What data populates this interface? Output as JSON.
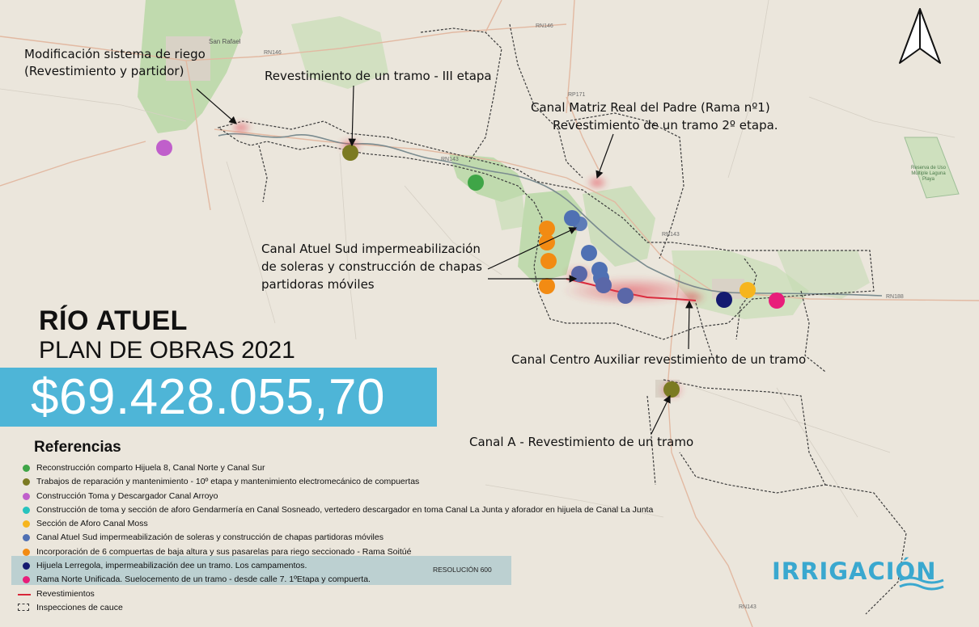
{
  "title": "RÍO ATUEL",
  "subtitle": "PLAN DE OBRAS 2021",
  "amount": "$69.428.055,70",
  "references_title": "Referencias",
  "legend": [
    {
      "text": "Reconstrucción comparto Hijuela 8, Canal Norte y Canal Sur",
      "color": "#3fa547"
    },
    {
      "text": "Trabajos de reparación y mantenimiento - 10º etapa y mantenimiento electromecánico de compuertas",
      "color": "#7b7a22"
    },
    {
      "text": "Construcción Toma y Descargador Canal Arroyo",
      "color": "#c05fcb"
    },
    {
      "text": "Construcción de toma y sección de aforo Gendarmería en Canal Sosneado, vertedero descargador en toma Canal La Junta y aforador en hijuela de Canal La Junta",
      "color": "#27c3be"
    },
    {
      "text": "Sección de Aforo Canal Moss",
      "color": "#f6b51e"
    },
    {
      "text": "Canal Atuel Sud impermeabilización de soleras y construcción de chapas partidoras móviles",
      "color": "#4f70b3"
    },
    {
      "text": "Incorporación de 6 compuertas de baja altura y sus pasarelas para riego seccionado - Rama Soitúé",
      "color": "#f28b13"
    },
    {
      "text": "Hijuela Lerregola, impermeabilización dee un tramo. Los campamentos.",
      "color": "#141a70"
    },
    {
      "text": "Rama Norte Unificada. Suelocemento de un tramo - desde calle 7. 1ºEtapa y compuerta.",
      "color": "#e81e7a"
    }
  ],
  "legend_revestimientos": "Revestimientos",
  "legend_inspecciones": "Inspecciones de cauce",
  "resolucion": "RESOLUCIÓN 600",
  "brand": "IRRIGACIÓN",
  "labels": {
    "modificacion": [
      "Modificación sistema de riego",
      "(Revestimiento y partidor)"
    ],
    "revestimiento_iii": "Revestimiento de un tramo - III etapa",
    "canal_matriz": [
      "Canal Matriz Real del Padre (Rama nº1)",
      "Revestimiento de un tramo 2º etapa."
    ],
    "atuel_sud": [
      "Canal Atuel Sud impermeabilización",
      "de soleras y construcción de chapas",
      "partidoras móviles"
    ],
    "centro_auxiliar": "Canal Centro Auxiliar revestimiento de un tramo",
    "canal_a": "Canal A - Revestimiento de un tramo"
  },
  "basemap_labels": {
    "san_rafael": "San Rafael",
    "rn146_a": "RN146",
    "rn146_b": "RN146",
    "rn143_a": "RN143",
    "rn143_b": "RN143",
    "rn143_c": "RN143",
    "rn188": "RN188",
    "rp171": "RP171",
    "reserva": "Reserva de Uso Múltiple Laguna Playa"
  },
  "colors": {
    "accent": "#4eb5d7",
    "revestimiento_line": "#d8273a",
    "background": "#ebe6dc"
  }
}
